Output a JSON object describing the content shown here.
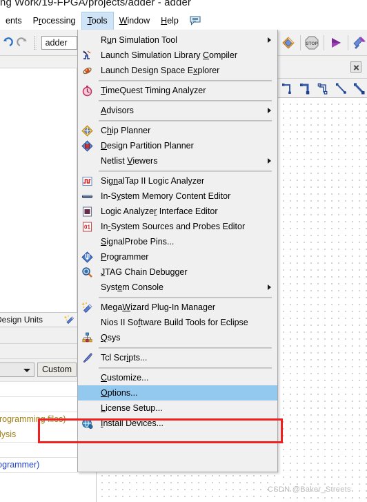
{
  "window": {
    "title": "ng Work/19-FPGA/projects/adder - adder",
    "watermark": "CSDN @Baker_Streets"
  },
  "menubar": {
    "items": [
      {
        "label": "ents",
        "mnemonic": "",
        "active": false
      },
      {
        "label": "Processing",
        "mnemonic": "r",
        "active": false
      },
      {
        "label": "Tools",
        "mnemonic": "T",
        "active": true
      },
      {
        "label": "Window",
        "mnemonic": "W",
        "active": false
      },
      {
        "label": "Help",
        "mnemonic": "H",
        "active": false
      }
    ],
    "chat_icon": "speech-bubble-icon"
  },
  "toolbar_left": {
    "undo_icon": "undo-icon",
    "redo_icon": "redo-icon",
    "project_combo_value": "adder"
  },
  "toolbar_right": {
    "items": [
      {
        "icon": "compile-icon"
      },
      {
        "icon": "stop-icon",
        "label": "STOP"
      },
      {
        "icon": "play-icon"
      },
      {
        "icon": "program-device-icon"
      }
    ],
    "close_icon": "close-icon",
    "draw_tools": [
      {
        "icon": "orthogonal-node-line-icon"
      },
      {
        "icon": "orthogonal-bus-line-icon"
      },
      {
        "icon": "orthogonal-conduit-line-icon"
      },
      {
        "icon": "diagonal-node-line-icon"
      },
      {
        "icon": "diagonal-bus-line-icon"
      }
    ]
  },
  "left_panel": {
    "header": "Design Units",
    "header_icon": "megawizard-icon",
    "filter_select_value": "",
    "custom_button": "Custom",
    "messages": [
      {
        "text": "programming files)",
        "color": "olive"
      },
      {
        "text": "alysis",
        "color": "olive"
      },
      {
        "text": "rogrammer)",
        "color": "blue"
      }
    ]
  },
  "tools_menu": {
    "items": [
      {
        "type": "item",
        "label": "Run Simulation Tool",
        "mnemonic": "u",
        "icon": null,
        "submenu": true,
        "selected": false
      },
      {
        "type": "item",
        "label": "Launch Simulation Library Compiler",
        "mnemonic": "C",
        "icon": "simulation-library-compiler-icon",
        "submenu": false,
        "selected": false
      },
      {
        "type": "item",
        "label": "Launch Design Space Explorer",
        "mnemonic": "x",
        "icon": "design-space-explorer-icon",
        "submenu": false,
        "selected": false
      },
      {
        "type": "separator"
      },
      {
        "type": "item",
        "label": "TimeQuest Timing Analyzer",
        "mnemonic": "T",
        "icon": "timequest-stopwatch-icon",
        "submenu": false,
        "selected": false
      },
      {
        "type": "separator"
      },
      {
        "type": "item",
        "label": "Advisors",
        "mnemonic": "A",
        "icon": null,
        "submenu": true,
        "selected": false
      },
      {
        "type": "separator"
      },
      {
        "type": "item",
        "label": "Chip Planner",
        "mnemonic": "h",
        "icon": "chip-planner-icon",
        "submenu": false,
        "selected": false
      },
      {
        "type": "item",
        "label": "Design Partition Planner",
        "mnemonic": "D",
        "icon": "design-partition-planner-icon",
        "submenu": false,
        "selected": false
      },
      {
        "type": "item",
        "label": "Netlist Viewers",
        "mnemonic": "V",
        "icon": null,
        "submenu": true,
        "selected": false
      },
      {
        "type": "separator"
      },
      {
        "type": "item",
        "label": "SignalTap II Logic Analyzer",
        "mnemonic": "n",
        "icon": "signaltap-icon",
        "submenu": false,
        "selected": false
      },
      {
        "type": "item",
        "label": "In-System Memory Content Editor",
        "mnemonic": "y",
        "icon": "memory-content-editor-icon",
        "submenu": false,
        "selected": false
      },
      {
        "type": "item",
        "label": "Logic Analyzer Interface Editor",
        "mnemonic": "r",
        "icon": "logic-analyzer-interface-icon",
        "submenu": false,
        "selected": false
      },
      {
        "type": "item",
        "label": "In-System Sources and Probes Editor",
        "mnemonic": "-",
        "icon": "sources-and-probes-icon",
        "submenu": false,
        "selected": false
      },
      {
        "type": "item",
        "label": "SignalProbe Pins...",
        "mnemonic": "S",
        "icon": null,
        "submenu": false,
        "selected": false
      },
      {
        "type": "item",
        "label": "Programmer",
        "mnemonic": "P",
        "icon": "programmer-icon",
        "submenu": false,
        "selected": false
      },
      {
        "type": "item",
        "label": "JTAG Chain Debugger",
        "mnemonic": "J",
        "icon": "jtag-chain-debugger-icon",
        "submenu": false,
        "selected": false
      },
      {
        "type": "item",
        "label": "System Console",
        "mnemonic": "e",
        "icon": null,
        "submenu": true,
        "selected": false
      },
      {
        "type": "separator"
      },
      {
        "type": "item",
        "label": "MegaWizard Plug-In Manager",
        "mnemonic": "W",
        "icon": "megawizard-icon",
        "submenu": false,
        "selected": false
      },
      {
        "type": "item",
        "label": "Nios II Software Build Tools for Eclipse",
        "mnemonic": "f",
        "icon": null,
        "submenu": false,
        "selected": false
      },
      {
        "type": "item",
        "label": "Qsys",
        "mnemonic": "Q",
        "icon": "qsys-icon",
        "submenu": false,
        "selected": false
      },
      {
        "type": "separator"
      },
      {
        "type": "item",
        "label": "Tcl Scripts...",
        "mnemonic": "i",
        "icon": "tcl-scripts-icon",
        "submenu": false,
        "selected": false
      },
      {
        "type": "separator"
      },
      {
        "type": "item",
        "label": "Customize...",
        "mnemonic": "C",
        "icon": null,
        "submenu": false,
        "selected": false
      },
      {
        "type": "item",
        "label": "Options...",
        "mnemonic": "O",
        "icon": null,
        "submenu": false,
        "selected": true
      },
      {
        "type": "item",
        "label": "License Setup...",
        "mnemonic": "L",
        "icon": null,
        "submenu": false,
        "selected": false
      },
      {
        "type": "item",
        "label": "Install Devices...",
        "mnemonic": "I",
        "icon": "install-devices-icon",
        "submenu": false,
        "selected": false
      }
    ]
  },
  "colors": {
    "menu_bg": "#f0f0f0",
    "menu_selected": "#93c9ee",
    "menubar_active": "#cfe4f7",
    "annotation_red": "#f02020",
    "message_olive": "#a08010",
    "message_blue": "#2244cc"
  }
}
